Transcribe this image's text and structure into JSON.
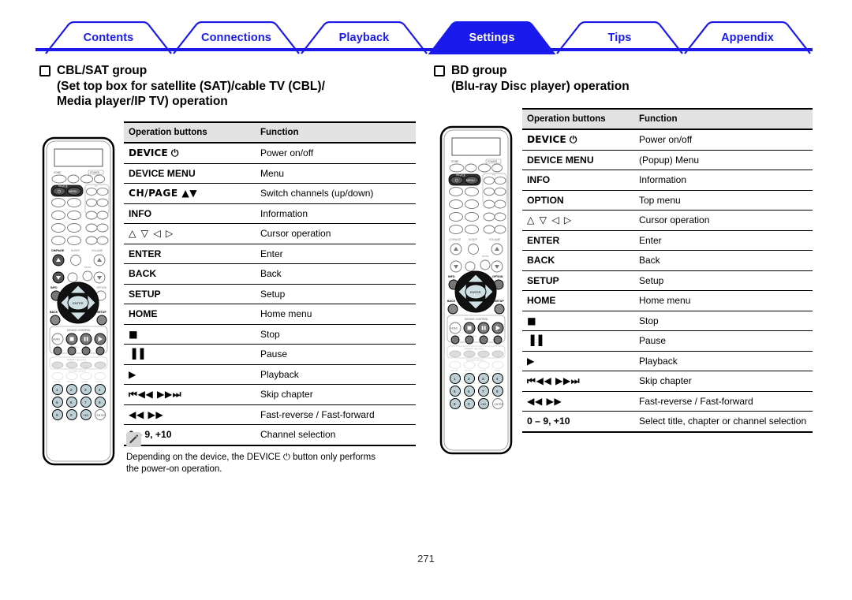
{
  "tabs": [
    {
      "label": "Contents",
      "active": false
    },
    {
      "label": "Connections",
      "active": false
    },
    {
      "label": "Playback",
      "active": false
    },
    {
      "label": "Settings",
      "active": true
    },
    {
      "label": "Tips",
      "active": false
    },
    {
      "label": "Appendix",
      "active": false
    }
  ],
  "accent_color": "#1a1aed",
  "left_section": {
    "heading_lines": [
      "CBL/SAT group",
      "(Set top box for satellite (SAT)/cable TV (CBL)/",
      "Media player/IP TV) operation"
    ],
    "table": {
      "headers": [
        "Operation buttons",
        "Function"
      ],
      "rows": [
        {
          "button": "DEVICE ⏻",
          "function": "Power on/off"
        },
        {
          "button": "DEVICE MENU",
          "function": "Menu"
        },
        {
          "button": "CH/PAGE ▲▼",
          "function": "Switch channels (up/down)"
        },
        {
          "button": "INFO",
          "function": "Information"
        },
        {
          "button": "△ ▽ ◁ ▷",
          "function": "Cursor operation"
        },
        {
          "button": "ENTER",
          "function": "Enter"
        },
        {
          "button": "BACK",
          "function": "Back"
        },
        {
          "button": "SETUP",
          "function": "Setup"
        },
        {
          "button": "HOME",
          "function": "Home menu"
        },
        {
          "button": "■",
          "function": "Stop"
        },
        {
          "button": "▐▐",
          "function": "Pause"
        },
        {
          "button": "▶",
          "function": "Playback"
        },
        {
          "button": "⏮◀◀ ▶▶⏭",
          "function": "Skip chapter"
        },
        {
          "button": "◀◀ ▶▶",
          "function": "Fast-reverse / Fast-forward"
        },
        {
          "button": "0 – 9, +10",
          "function": "Channel selection"
        }
      ]
    },
    "note": "Depending on the device, the DEVICE ⏻ button only performs the power-on operation.",
    "note_line1": "Depending on the device, the DEVICE ⏻ button only performs",
    "note_line2": "the power-on operation.",
    "note_icon": "pencil-icon"
  },
  "right_section": {
    "heading_lines": [
      "BD group",
      "(Blu-ray Disc player) operation"
    ],
    "table": {
      "headers": [
        "Operation buttons",
        "Function"
      ],
      "rows": [
        {
          "button": "DEVICE ⏻",
          "function": "Power on/off"
        },
        {
          "button": "DEVICE MENU",
          "function": "(Popup) Menu"
        },
        {
          "button": "INFO",
          "function": "Information"
        },
        {
          "button": "OPTION",
          "function": "Top menu"
        },
        {
          "button": "△ ▽ ◁ ▷",
          "function": "Cursor operation"
        },
        {
          "button": "ENTER",
          "function": "Enter"
        },
        {
          "button": "BACK",
          "function": "Back"
        },
        {
          "button": "SETUP",
          "function": "Setup"
        },
        {
          "button": "HOME",
          "function": "Home menu"
        },
        {
          "button": "■",
          "function": "Stop"
        },
        {
          "button": "▐▐",
          "function": "Pause"
        },
        {
          "button": "▶",
          "function": "Playback"
        },
        {
          "button": "⏮◀◀ ▶▶⏭",
          "function": "Skip chapter"
        },
        {
          "button": "◀◀ ▶▶",
          "function": "Fast-reverse / Fast-forward"
        },
        {
          "button": "0 – 9, +10",
          "function": "Select title, chapter or channel selection"
        }
      ]
    }
  },
  "remote_left": {
    "name": "remote-control-cbl-sat",
    "highlighted_buttons": [
      "DEVICE power",
      "DEVICE MENU",
      "CH/PAGE up",
      "CH/PAGE down",
      "INFO",
      "cursor pad",
      "ENTER",
      "BACK",
      "SETUP",
      "stop",
      "pause",
      "play",
      "skip",
      "numbers"
    ]
  },
  "remote_right": {
    "name": "remote-control-bd",
    "highlighted_buttons": [
      "DEVICE power",
      "DEVICE MENU",
      "INFO",
      "OPTION",
      "cursor pad",
      "ENTER",
      "BACK",
      "SETUP",
      "stop",
      "pause",
      "play",
      "skip",
      "numbers"
    ]
  },
  "page_number": "271"
}
